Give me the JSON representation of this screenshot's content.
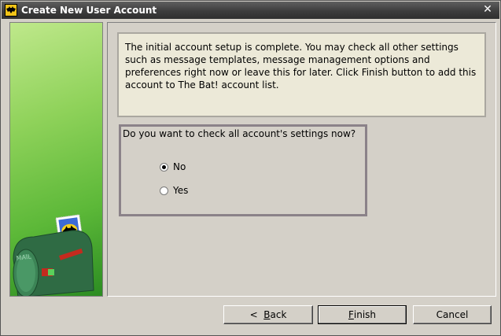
{
  "window": {
    "title": "Create New User Account",
    "close_glyph": "✕"
  },
  "info": {
    "text": "The initial account setup is complete. You may check all other settings such as message templates, message management options and preferences right now or leave this for later. Click Finish button to add this account to The Bat! account list."
  },
  "question": {
    "label": "Do you want to check all account's settings now?",
    "options": [
      {
        "label": "No",
        "selected": true
      },
      {
        "label": "Yes",
        "selected": false
      }
    ]
  },
  "buttons": {
    "back": {
      "prefix": "<  ",
      "accel": "B",
      "rest": "ack"
    },
    "finish": {
      "accel": "F",
      "rest": "inish"
    },
    "cancel": "Cancel"
  },
  "mailbox_label": "MAIL"
}
